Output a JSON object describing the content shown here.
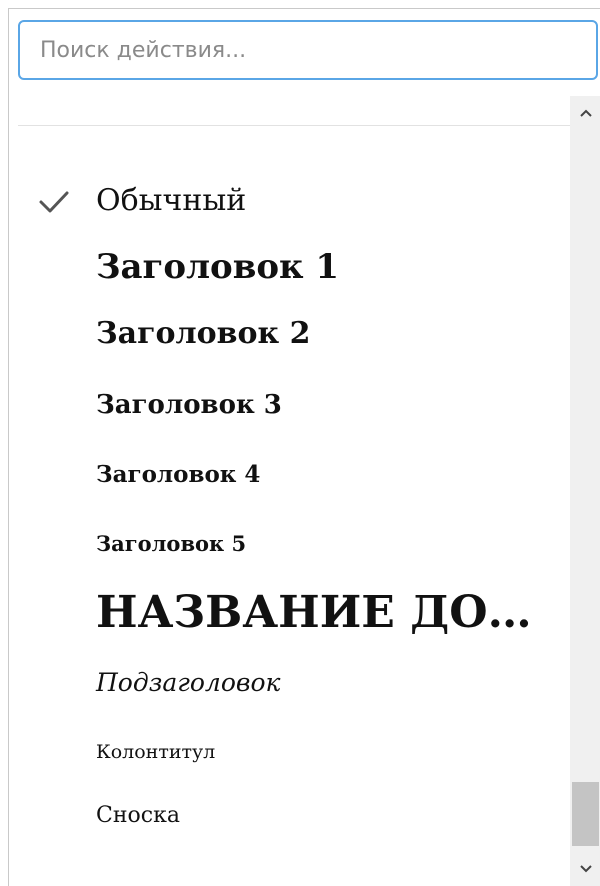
{
  "search": {
    "placeholder": "Поиск действия..."
  },
  "styles": {
    "selected_index": 0,
    "items": [
      {
        "label": "Обычный",
        "checked": true
      },
      {
        "label": "Заголовок 1",
        "checked": false
      },
      {
        "label": "Заголовок 2",
        "checked": false
      },
      {
        "label": "Заголовок 3",
        "checked": false
      },
      {
        "label": "Заголовок 4",
        "checked": false
      },
      {
        "label": "Заголовок 5",
        "checked": false
      },
      {
        "label": "НАЗВАНИЕ ДО…",
        "checked": false
      },
      {
        "label": "Подзаголовок",
        "checked": false
      },
      {
        "label": "Колонтитул",
        "checked": false
      },
      {
        "label": "Сноска",
        "checked": false
      }
    ]
  },
  "scrollbar": {
    "up_icon": "chevron-up-icon",
    "down_icon": "chevron-down-icon",
    "position": 0.92
  },
  "colors": {
    "focus_border": "#5aa6e6",
    "checkmark": "#555555",
    "scrollbar_thumb": "#c4c4c4"
  }
}
